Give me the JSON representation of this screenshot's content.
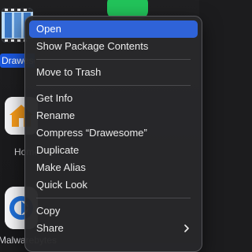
{
  "desktop": {
    "drawesome_label": "Drawesome",
    "home_label": "Home",
    "bottom_label": "Malwarebytes"
  },
  "menu": {
    "group1": [
      {
        "id": "open",
        "label": "Open",
        "highlighted": true
      },
      {
        "id": "show-package-contents",
        "label": "Show Package Contents"
      }
    ],
    "group2": [
      {
        "id": "move-to-trash",
        "label": "Move to Trash"
      }
    ],
    "group3": [
      {
        "id": "get-info",
        "label": "Get Info"
      },
      {
        "id": "rename",
        "label": "Rename"
      },
      {
        "id": "compress",
        "label": "Compress “Drawesome”"
      },
      {
        "id": "duplicate",
        "label": "Duplicate"
      },
      {
        "id": "make-alias",
        "label": "Make Alias"
      },
      {
        "id": "quick-look",
        "label": "Quick Look"
      }
    ],
    "group4": [
      {
        "id": "copy",
        "label": "Copy"
      },
      {
        "id": "share",
        "label": "Share",
        "has_submenu": true
      }
    ]
  },
  "colors": {
    "highlight": "#2f63d8",
    "menu_bg": "#28282a",
    "selection_label_bg": "#1a56db"
  }
}
